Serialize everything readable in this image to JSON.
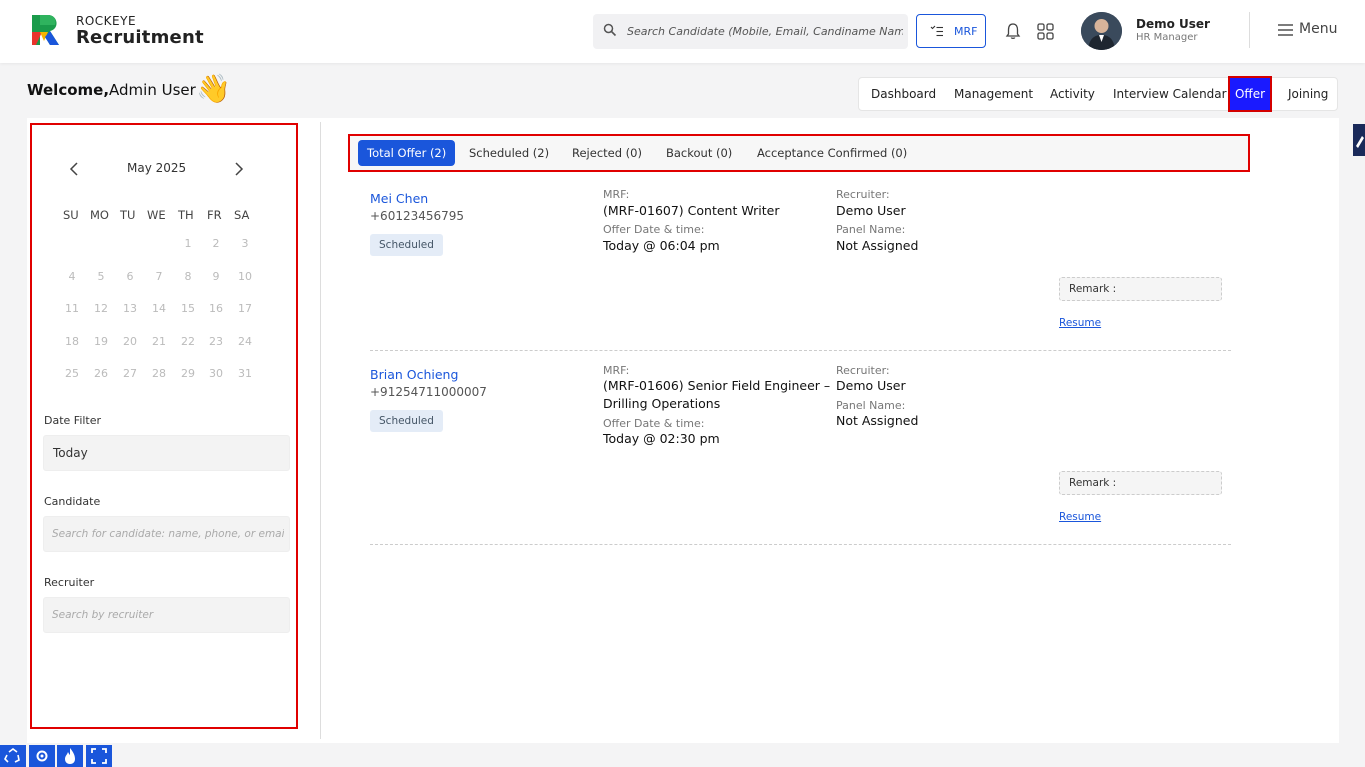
{
  "brand": {
    "top": "ROCKEYE",
    "name": "Recruitment"
  },
  "search": {
    "placeholder": "Search Candidate (Mobile, Email, Candiname Name)"
  },
  "header": {
    "mrf_label": "MRF",
    "user_name": "Demo User",
    "user_role": "HR Manager",
    "menu_label": "Menu"
  },
  "welcome": {
    "greeting": "Welcome,",
    "name": "Admin User"
  },
  "nav_tabs": [
    "Dashboard",
    "Management",
    "Activity",
    "Interview Calendar",
    "Offer",
    "Joining"
  ],
  "calendar": {
    "month": "May 2025",
    "weekdays": [
      "SU",
      "MO",
      "TU",
      "WE",
      "TH",
      "FR",
      "SA"
    ],
    "weeks": [
      [
        "",
        "",
        "",
        "",
        "1",
        "2",
        "3"
      ],
      [
        "4",
        "5",
        "6",
        "7",
        "8",
        "9",
        "10"
      ],
      [
        "11",
        "12",
        "13",
        "14",
        "15",
        "16",
        "17"
      ],
      [
        "18",
        "19",
        "20",
        "21",
        "22",
        "23",
        "24"
      ],
      [
        "25",
        "26",
        "27",
        "28",
        "29",
        "30",
        "31"
      ]
    ]
  },
  "filters": {
    "date_label": "Date Filter",
    "date_value": "Today",
    "candidate_label": "Candidate",
    "candidate_placeholder": "Search for candidate: name, phone, or email",
    "recruiter_label": "Recruiter",
    "recruiter_placeholder": "Search by recruiter"
  },
  "status_tabs": [
    "Total Offer (2)",
    "Scheduled (2)",
    "Rejected (0)",
    "Backout (0)",
    "Acceptance Confirmed (0)"
  ],
  "labels": {
    "mrf": "MRF:",
    "offer_date": "Offer Date & time:",
    "recruiter": "Recruiter:",
    "panel": "Panel Name:",
    "remark": "Remark :",
    "resume": "Resume"
  },
  "candidates": [
    {
      "name": "Mei Chen",
      "phone": "+60123456795",
      "status": "Scheduled",
      "mrf_line1": "(MRF-01607) Content Writer",
      "mrf_line2": "",
      "offer_datetime": "Today @ 06:04 pm",
      "recruiter": "Demo User",
      "panel": "Not Assigned"
    },
    {
      "name": "Brian Ochieng",
      "phone": "+91254711000007",
      "status": "Scheduled",
      "mrf_line1": "(MRF-01606) Senior Field Engineer –",
      "mrf_line2": "Drilling Operations",
      "offer_datetime": "Today @ 02:30 pm",
      "recruiter": "Demo User",
      "panel": "Not Assigned"
    }
  ],
  "colors": {
    "accent": "#1a56db",
    "highlight": "#e00000",
    "active_nav": "#1a1aff"
  }
}
